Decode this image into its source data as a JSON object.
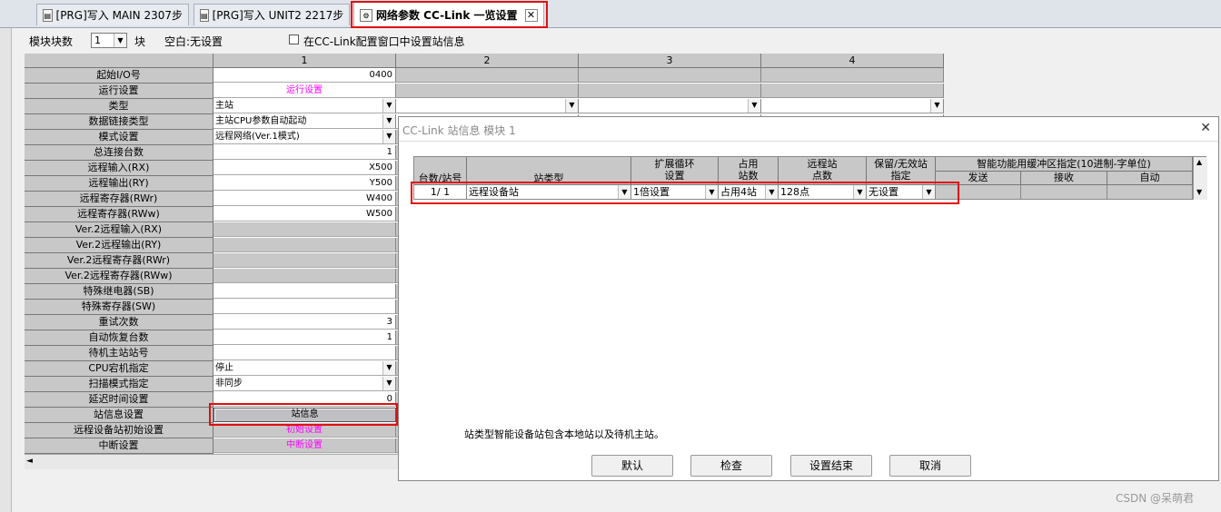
{
  "tabs": [
    {
      "label": "[PRG]写入 MAIN 2307步",
      "icon": "prg-icon"
    },
    {
      "label": "[PRG]写入 UNIT2 2217步",
      "icon": "prg-icon"
    },
    {
      "label": "网络参数 CC-Link 一览设置",
      "icon": "network-param-icon"
    }
  ],
  "toolbar": {
    "module_count_label": "模块块数",
    "module_count_value": "1",
    "module_unit": "块",
    "blank_note": "空白:无设置",
    "station_info_checkbox_label": "在CC-Link配置窗口中设置站信息"
  },
  "grid": {
    "columns": [
      "1",
      "2",
      "3",
      "4"
    ],
    "rows": [
      {
        "label": "起始I/O号",
        "value": "0400"
      },
      {
        "label": "运行设置",
        "value": "运行设置"
      },
      {
        "label": "类型",
        "value": "主站"
      },
      {
        "label": "数据链接类型",
        "value": "主站CPU参数自动起动"
      },
      {
        "label": "模式设置",
        "value": "远程网络(Ver.1模式)"
      },
      {
        "label": "总连接台数",
        "value": "1"
      },
      {
        "label": "远程输入(RX)",
        "value": "X500"
      },
      {
        "label": "远程输出(RY)",
        "value": "Y500"
      },
      {
        "label": "远程寄存器(RWr)",
        "value": "W400"
      },
      {
        "label": "远程寄存器(RWw)",
        "value": "W500"
      },
      {
        "label": "Ver.2远程输入(RX)",
        "value": ""
      },
      {
        "label": "Ver.2远程输出(RY)",
        "value": ""
      },
      {
        "label": "Ver.2远程寄存器(RWr)",
        "value": ""
      },
      {
        "label": "Ver.2远程寄存器(RWw)",
        "value": ""
      },
      {
        "label": "特殊继电器(SB)",
        "value": ""
      },
      {
        "label": "特殊寄存器(SW)",
        "value": ""
      },
      {
        "label": "重试次数",
        "value": "3"
      },
      {
        "label": "自动恢复台数",
        "value": "1"
      },
      {
        "label": "待机主站站号",
        "value": ""
      },
      {
        "label": "CPU宕机指定",
        "value": "停止"
      },
      {
        "label": "扫描模式指定",
        "value": "非同步"
      },
      {
        "label": "延迟时间设置",
        "value": "0"
      },
      {
        "label": "站信息设置",
        "value": "站信息"
      },
      {
        "label": "远程设备站初始设置",
        "value": "初始设置"
      },
      {
        "label": "中断设置",
        "value": "中断设置"
      }
    ]
  },
  "dialog": {
    "title": "CC-Link 站信息 模块 1",
    "headers": {
      "station_no": "台数/站号",
      "station_type": "站类型",
      "ext_cycle_1": "扩展循环",
      "ext_cycle_2": "设置",
      "occupied_1": "占用",
      "occupied_2": "站数",
      "remote_points_1": "远程站",
      "remote_points_2": "点数",
      "reserve_1": "保留/无效站",
      "reserve_2": "指定",
      "buffer": "智能功能用缓冲区指定(10进制-字单位)",
      "send": "发送",
      "receive": "接收",
      "auto": "自动"
    },
    "row": {
      "station_no": "1/ 1",
      "station_type": "远程设备站",
      "ext_cycle": "1倍设置",
      "occupied": "占用4站",
      "remote_points": "128点",
      "reserve": "无设置"
    },
    "note": "站类型智能设备站包含本地站以及待机主站。",
    "buttons": {
      "default": "默认",
      "check": "检查",
      "finish": "设置结束",
      "cancel": "取消"
    }
  },
  "watermark": "CSDN @呆萌君",
  "colors": {
    "highlight": "#e01010",
    "magenta_text": "#ff00ff",
    "grid_gray": "#c8c8c8"
  }
}
